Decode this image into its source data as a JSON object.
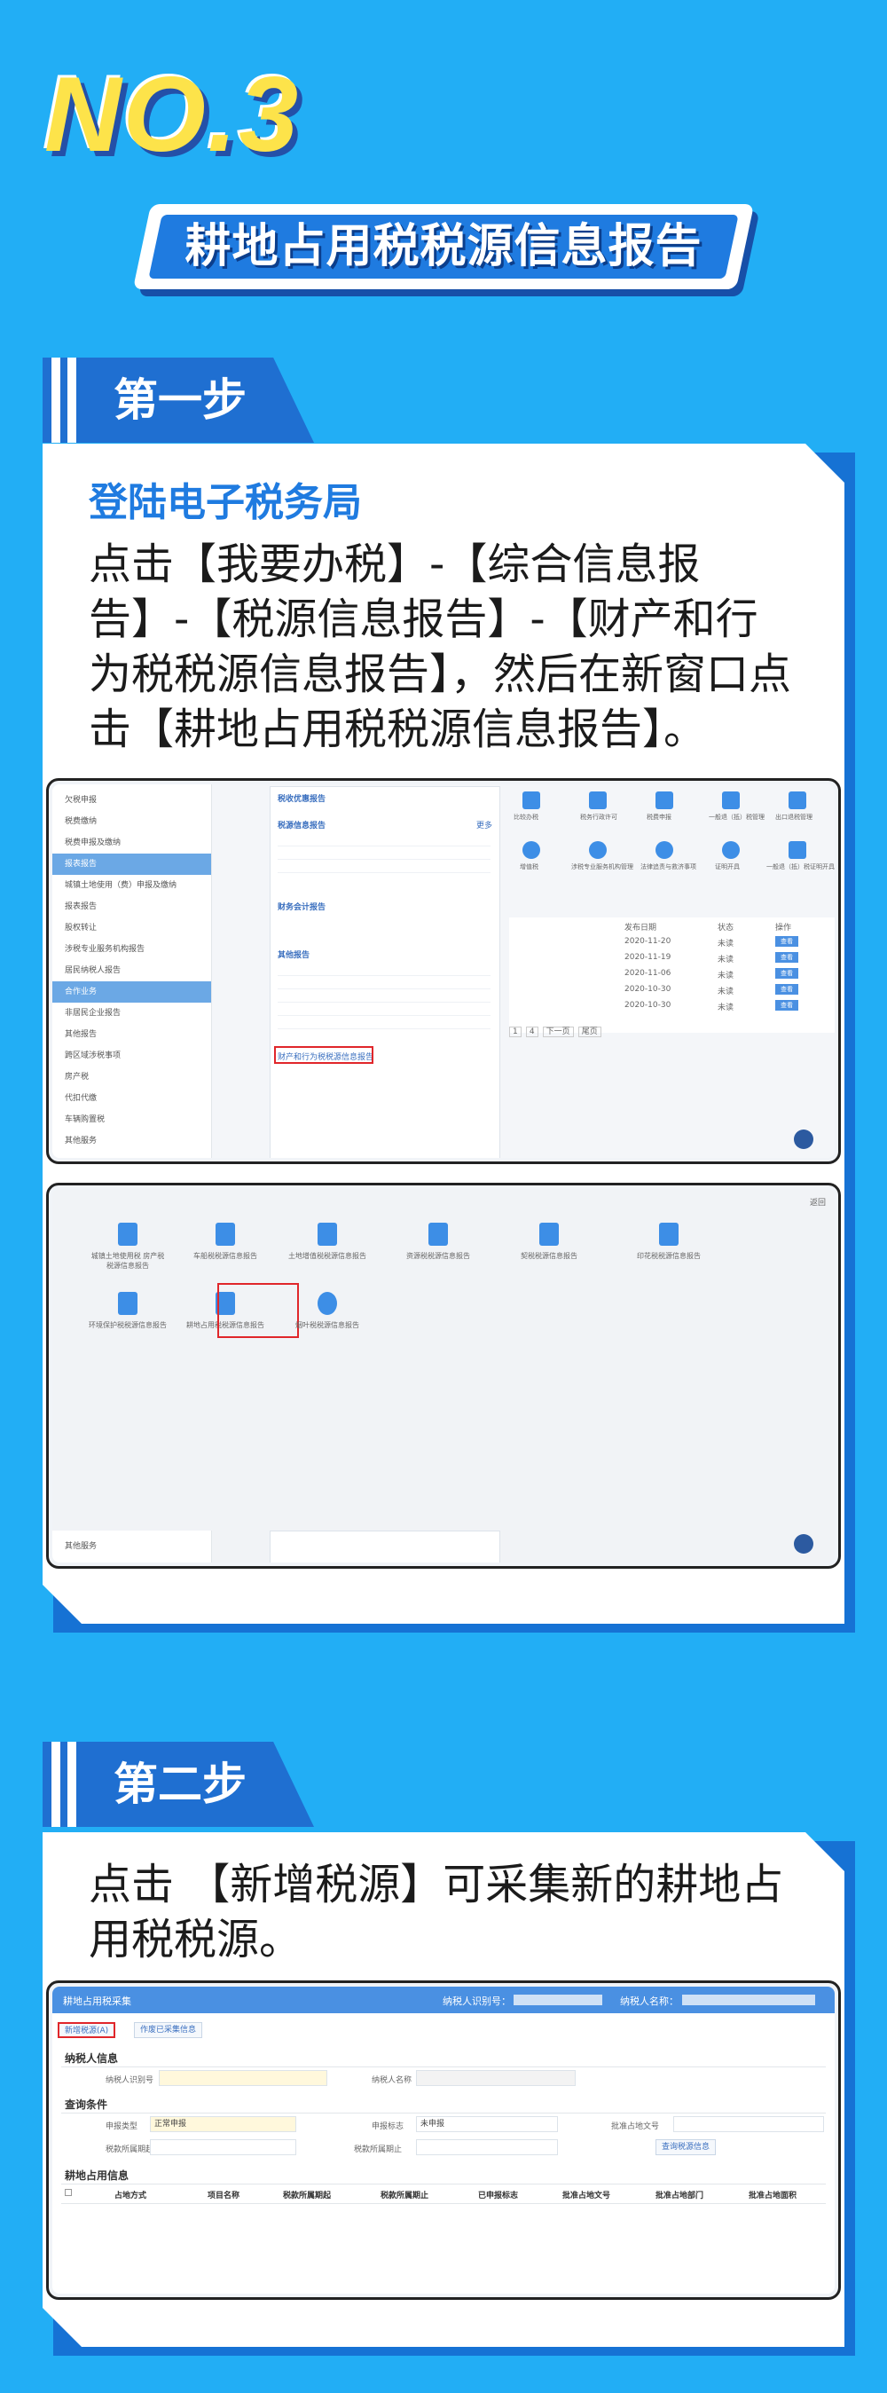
{
  "header": {
    "number": "NO.3",
    "title": "耕地占用税税源信息报告"
  },
  "step1": {
    "tab": "第一步",
    "subtitle": "登陆电子税务局",
    "text": "点击【我要办税】-【综合信息报告】-【税源信息报告】-【财产和行为税税源信息报告】，然后在新窗口点击【耕地占用税税源信息报告】。",
    "shot1": {
      "sidebar": [
        "欠税申报",
        "税费缴纳",
        "税费申报及缴纳",
        "报表报告",
        "城镇土地使用（费）申报及缴纳",
        "报表报告",
        "股权转让",
        "涉税专业服务机构报告",
        "居民纳税人报告",
        "合作业务",
        "非居民企业报告",
        "其他报告",
        "跨区域涉税事项",
        "房产税",
        "代扣代缴",
        "车辆购置税",
        "其他服务"
      ],
      "highlight_item": "财产和行为税税源信息报告",
      "menu_heads": [
        "税收优惠报告",
        "税源信息报告",
        "财务会计报告",
        "其他报告"
      ],
      "more_label": "更多",
      "pager": [
        "1",
        "4",
        "下一页",
        "尾页"
      ],
      "right_icons": [
        "比较办税",
        "税务行政许可",
        "税费申报",
        "一般退（抵）税管理",
        "出口退税管理",
        "增值税",
        "涉税专业服务机构管理",
        "法律追责与救济事项",
        "证明开具",
        "一般退（抵）税证明开具"
      ],
      "table_head": [
        "发布日期",
        "状态",
        "操作"
      ],
      "table_rows": [
        [
          "2020-11-20",
          "未读",
          "查看"
        ],
        [
          "2020-11-19",
          "未读",
          "查看"
        ],
        [
          "2020-11-06",
          "未读",
          "查看"
        ],
        [
          "2020-10-30",
          "未读",
          "查看"
        ],
        [
          "2020-10-30",
          "未读",
          "查看"
        ]
      ]
    },
    "shot2": {
      "back": "返回",
      "tiles": [
        "城镇土地使用税 房产税税源信息报告",
        "车船税税源信息报告",
        "土地增值税税源信息报告",
        "资源税税源信息报告",
        "契税税源信息报告",
        "印花税税源信息报告",
        "环境保护税税源信息报告",
        "耕地占用税税源信息报告",
        "烟叶税税源信息报告"
      ],
      "side_footer": "其他服务"
    }
  },
  "step2": {
    "tab": "第二步",
    "text": "点击 【新增税源】可采集新的耕地占用税税源。",
    "shot": {
      "bar_title": "耕地占用税采集",
      "bar_taxno_label": "纳税人识别号：",
      "bar_name_label": "纳税人名称：",
      "btn_add": "新增税源(A)",
      "btn_query": "作废已采集信息",
      "sec_taxpayer": "纳税人信息",
      "lbl_taxno": "纳税人识别号",
      "lbl_name": "纳税人名称",
      "sec_query": "查询条件",
      "lbl_decl_type": "申报类型",
      "val_decl_type": "正常申报",
      "lbl_decl_flag": "申报标志",
      "val_decl_flag": "未申报",
      "lbl_doc": "批准占地文号",
      "lbl_start": "税款所属期起",
      "lbl_end": "税款所属期止",
      "btn_search": "查询税源信息",
      "sec_info": "耕地占用信息",
      "columns": [
        "占地方式",
        "项目名称",
        "税款所属期起",
        "税款所属期止",
        "已申报标志",
        "批准占地文号",
        "批准占地部门",
        "批准占地面积"
      ]
    }
  },
  "colors": {
    "background": "#22aef5",
    "accent": "#1f7be0",
    "title_yellow": "#fde34a",
    "alert": "#e0262a"
  }
}
